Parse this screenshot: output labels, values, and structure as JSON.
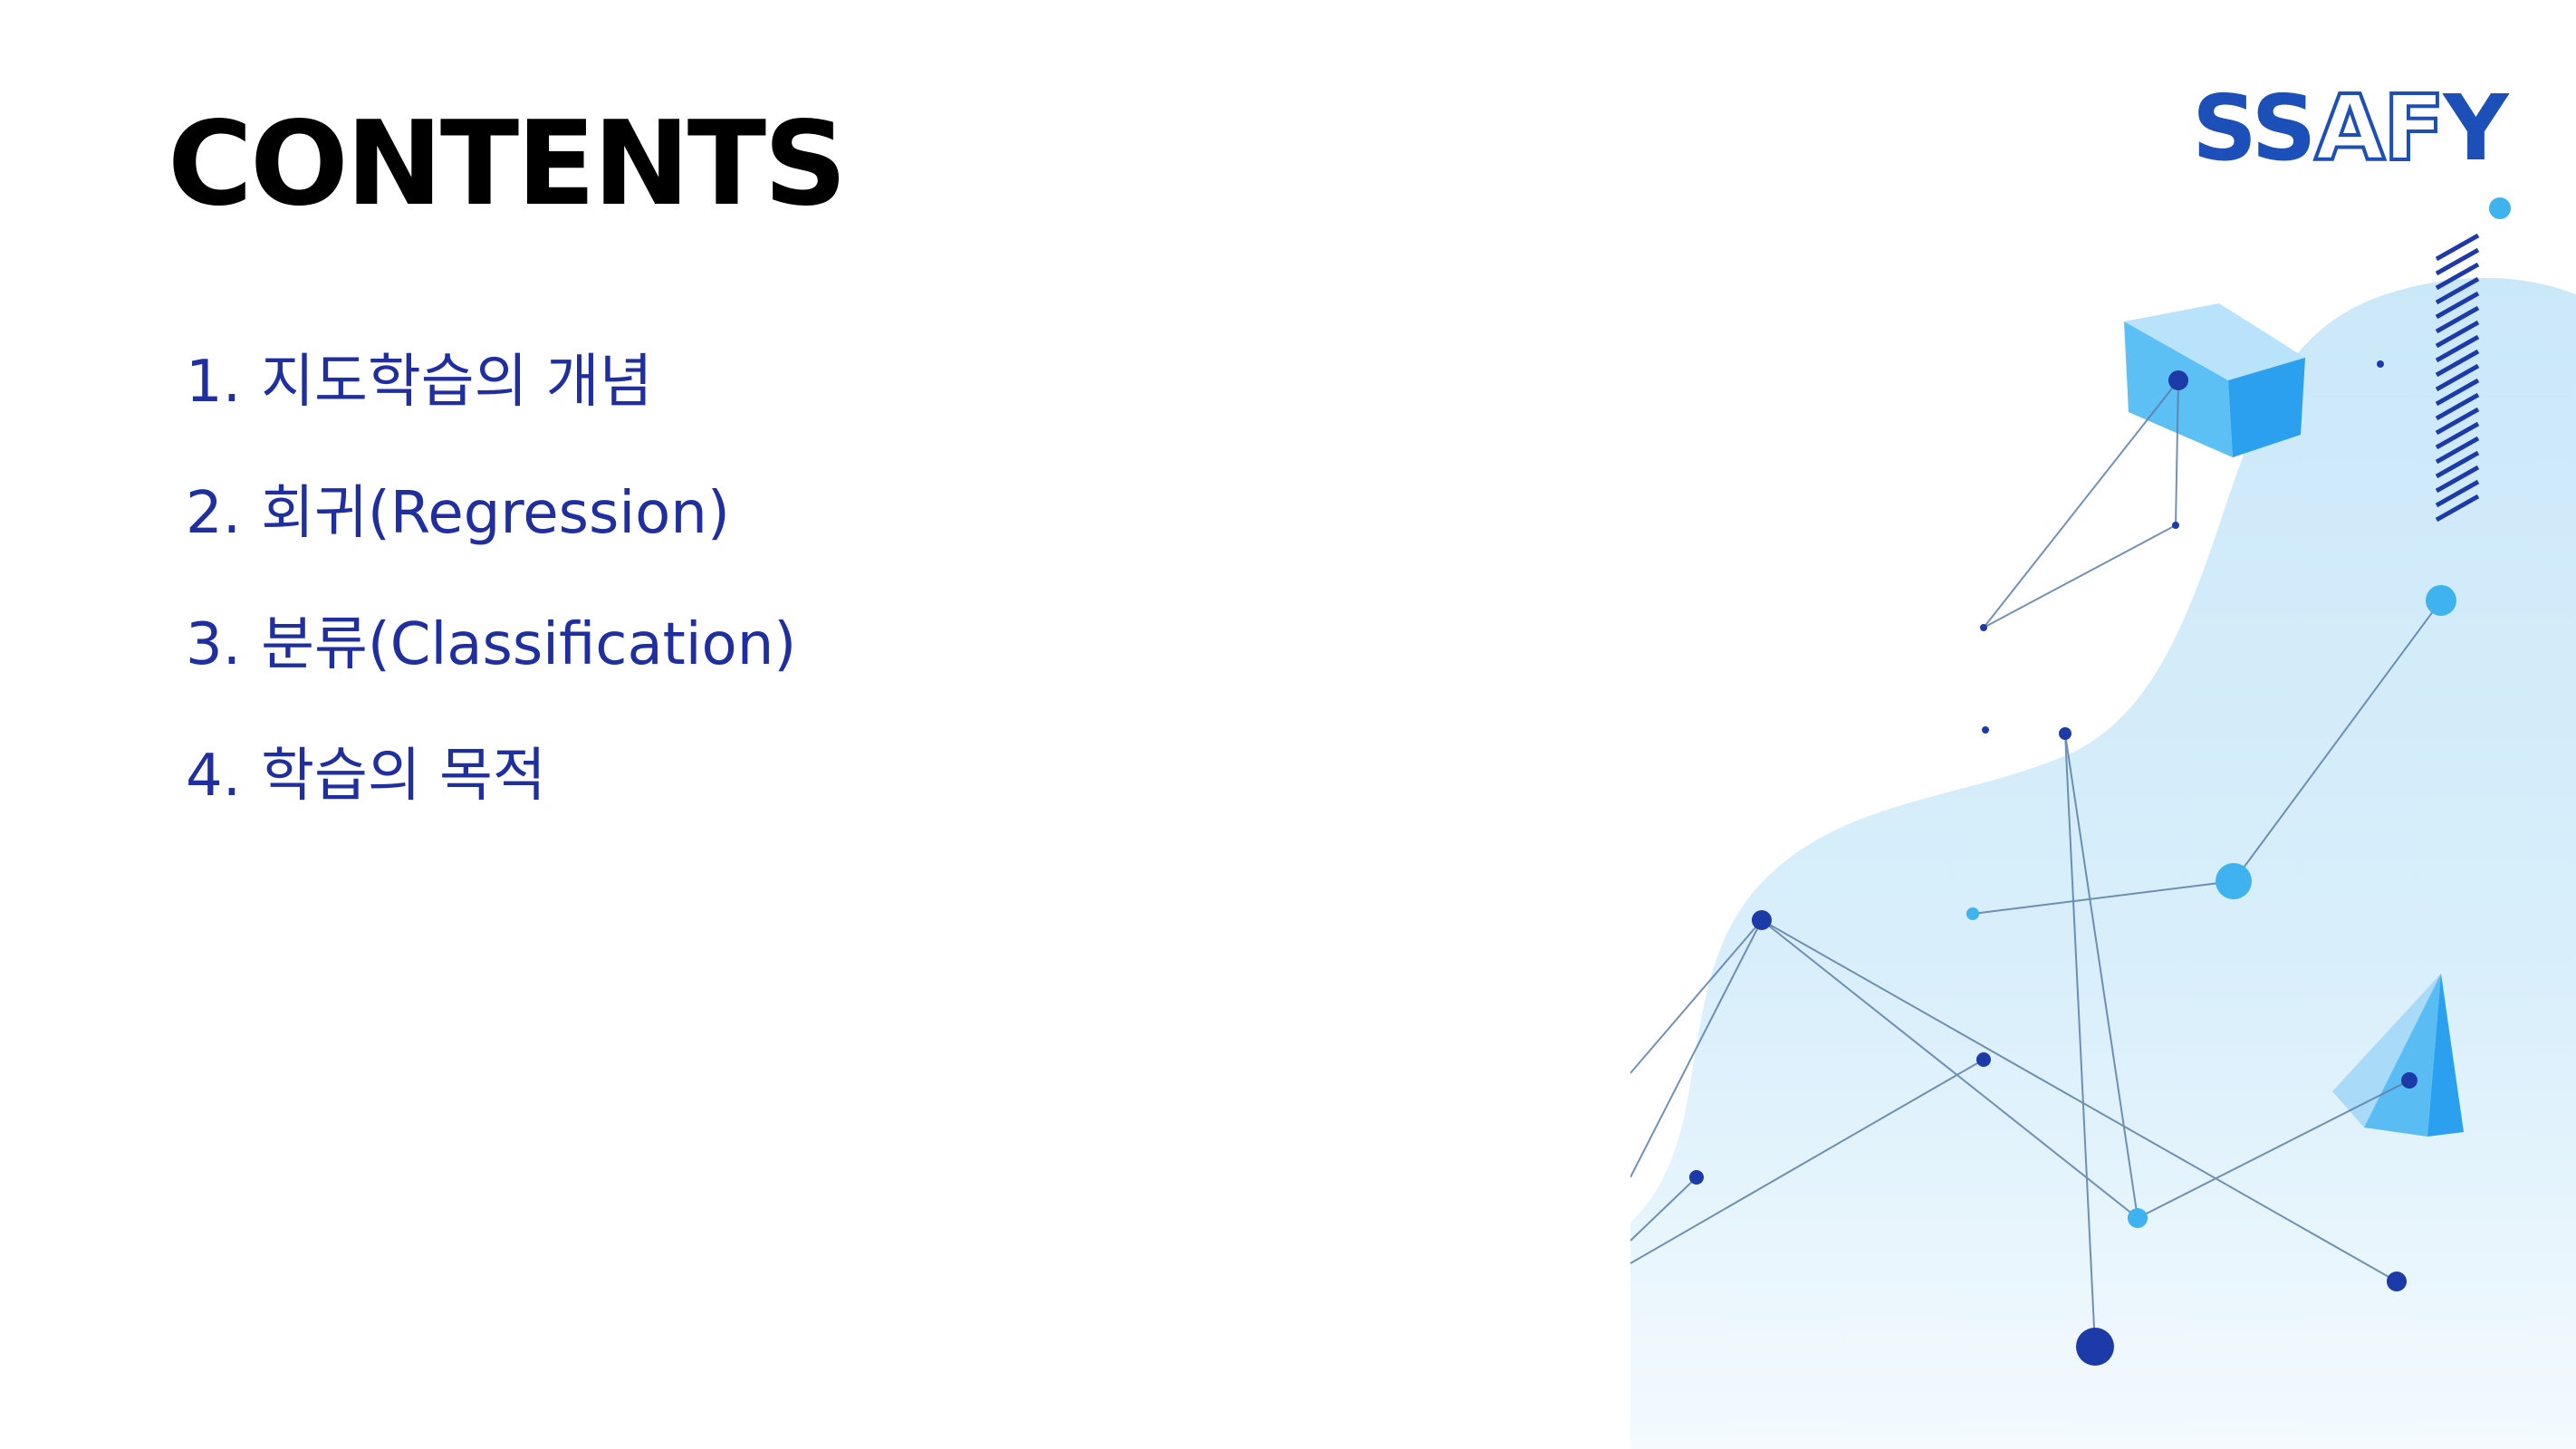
{
  "slide": {
    "title": "CONTENTS",
    "items": [
      {
        "num": "1.",
        "label": "지도학습의 개념"
      },
      {
        "num": "2.",
        "label": "회귀(Regression)"
      },
      {
        "num": "3.",
        "label": "분류(Classification)"
      },
      {
        "num": "4.",
        "label": "학습의 목적"
      }
    ]
  },
  "logo": {
    "part1": "SS",
    "part2": "AF",
    "part3": "Y"
  },
  "colors": {
    "title": "#000000",
    "list_text": "#1f2fa0",
    "brand_blue": "#1d4fb8",
    "blob_light": "#d6ecfa",
    "node_dark": "#1c3aa8",
    "node_light": "#3fb2f0"
  }
}
